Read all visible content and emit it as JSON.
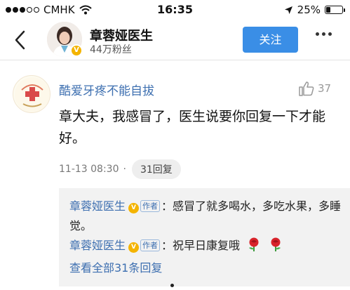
{
  "status_bar": {
    "carrier": "CMHK",
    "time": "16:35",
    "battery": "25%",
    "battery_level": 0.25,
    "signal_dots_filled": 3,
    "signal_dots_total": 5
  },
  "header": {
    "user_name": "章蓉娅医生",
    "fans": "44万粉丝",
    "follow_label": "关注",
    "verified_badge": "V"
  },
  "comment": {
    "author": "酷爱牙疼不能自拔",
    "likes": "37",
    "text": "章大夫，我感冒了，医生说要你回复一下才能好。",
    "date": "11-13 08:30",
    "separator": "·",
    "reply_count_label": "31回复"
  },
  "replies": [
    {
      "name": "章蓉娅医生",
      "tag": "作者",
      "text": "：感冒了就多喝水，多吃水果，多睡觉。"
    },
    {
      "name": "章蓉娅医生",
      "tag": "作者",
      "text": "：祝早日康复哦"
    }
  ],
  "view_all_label": "查看全部31条回复",
  "icons": [
    "back-arrow-icon",
    "wifi-icon",
    "location-arrow-icon",
    "battery-icon",
    "more-dots-icon",
    "thumbs-up-icon",
    "rose-icon"
  ],
  "colors": {
    "link_blue": "#3d6fb0",
    "follow_button": "#3a8ee6",
    "verified_gold": "#f4b400",
    "reply_bg": "#f2f2f2"
  }
}
